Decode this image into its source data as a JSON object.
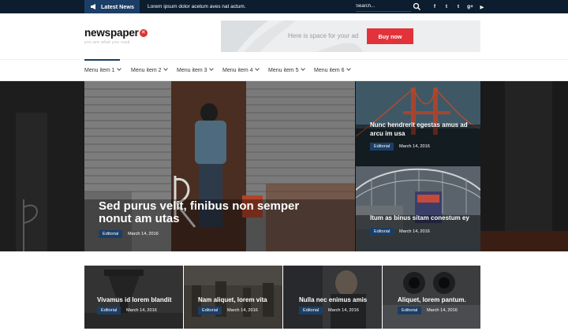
{
  "topbar": {
    "latest_label": "Latest News",
    "ticker_text": "Lorem ipsum dolor acetum aves nat actum.",
    "search_placeholder": "Search...",
    "social_icons": [
      "facebook-icon",
      "tumblr-icon",
      "twitter-icon",
      "googleplus-icon",
      "youtube-icon"
    ],
    "social_glyphs": [
      "f",
      "t",
      "t",
      "g+",
      "▶"
    ]
  },
  "header": {
    "logo_text": "newspaper",
    "tagline": "you are what you read",
    "ad_text": "Here is space for your ad",
    "ad_button": "Buy now"
  },
  "menu": {
    "items": [
      "Menu item 1",
      "Menu item 2",
      "Menu item 3",
      "Menu item 4",
      "Menu item 5",
      "Menu item 6"
    ]
  },
  "hero": {
    "main": {
      "title": "Sed purus velit, finibus non semper nonut am utas",
      "tag": "Editorial",
      "date": "March 14, 2016"
    },
    "side": [
      {
        "title": "Nunc hendrerit egestas amus ad arcu im usa",
        "tag": "Editorial",
        "date": "March 14, 2016"
      },
      {
        "title": "Itum as binus sitam conestum ey",
        "tag": "Editorial",
        "date": "March 14, 2016"
      }
    ]
  },
  "bottom": [
    {
      "title": "Vivamus id lorem blandit",
      "tag": "Editorial",
      "date": "March 14, 2016"
    },
    {
      "title": "Nam aliquet, lorem vita",
      "tag": "Editorial",
      "date": "March 14, 2016"
    },
    {
      "title": "Nulla nec enimus amis",
      "tag": "Editorial",
      "date": "March 14, 2016"
    },
    {
      "title": "Aliquet, lorem pantum.",
      "tag": "Editorial",
      "date": "March 14, 2016"
    }
  ],
  "colors": {
    "topbar": "#0b1d2e",
    "accent": "#1b3e66",
    "brand_red": "#e2323a"
  }
}
